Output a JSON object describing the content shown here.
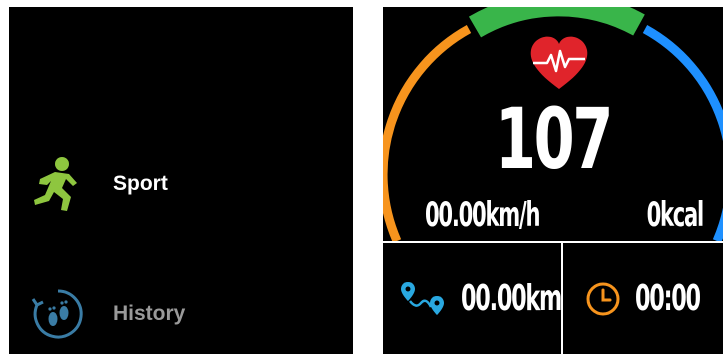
{
  "menu": {
    "items": [
      {
        "label": "Sport",
        "icon": "running-person-icon",
        "state": "selected"
      },
      {
        "label": "History",
        "icon": "footprints-icon",
        "state": "dimmed"
      }
    ]
  },
  "workout": {
    "heart_rate": "107",
    "heart_icon": "heart-pulse-icon",
    "speed": "00.00km/h",
    "calories": "0kcal",
    "distance": "00.00km",
    "distance_icon": "route-icon",
    "duration": "00:00",
    "duration_icon": "clock-icon"
  },
  "colors": {
    "background": "#000000",
    "accent_green": "#8ec63f",
    "arc_orange": "#f7941d",
    "arc_green": "#39b54a",
    "arc_blue": "#1e90ff",
    "heart_red": "#e0242b",
    "route_blue": "#29a8e0",
    "clock_orange": "#f7941d",
    "history_icon": "#3a7ca5"
  }
}
